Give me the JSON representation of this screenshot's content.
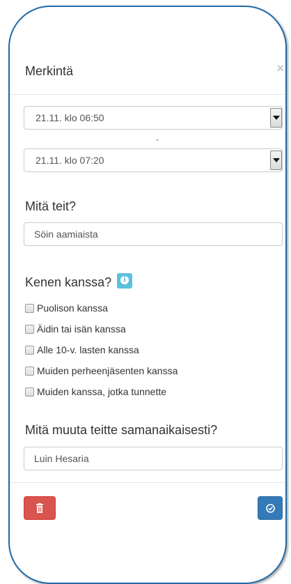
{
  "modal": {
    "title": "Merkintä",
    "close_symbol": "×"
  },
  "time": {
    "start_value": "21.11. klo 06:50",
    "separator": "-",
    "end_value": "21.11. klo 07:20"
  },
  "activity": {
    "heading": "Mitä teit?",
    "value": "Söin aamiaista"
  },
  "company": {
    "heading": "Kenen kanssa?",
    "info_icon": "info-icon",
    "options": [
      {
        "label": "Puolison kanssa",
        "checked": false
      },
      {
        "label": "Äidin tai isän kanssa",
        "checked": false
      },
      {
        "label": "Alle 10-v. lasten kanssa",
        "checked": false
      },
      {
        "label": "Muiden perheenjäsenten kanssa",
        "checked": false
      },
      {
        "label": "Muiden kanssa, jotka tunnette",
        "checked": false
      }
    ]
  },
  "simultaneous": {
    "heading": "Mitä muuta teitte samanaikaisesti?",
    "value": "Luin Hesaria"
  },
  "footer": {
    "delete_icon": "trash-icon",
    "confirm_icon": "check-circle-icon"
  },
  "colors": {
    "frame_border": "#1f6aa8",
    "delete_button": "#d9534f",
    "confirm_button": "#337ab7",
    "info_badge": "#5bc0de"
  }
}
